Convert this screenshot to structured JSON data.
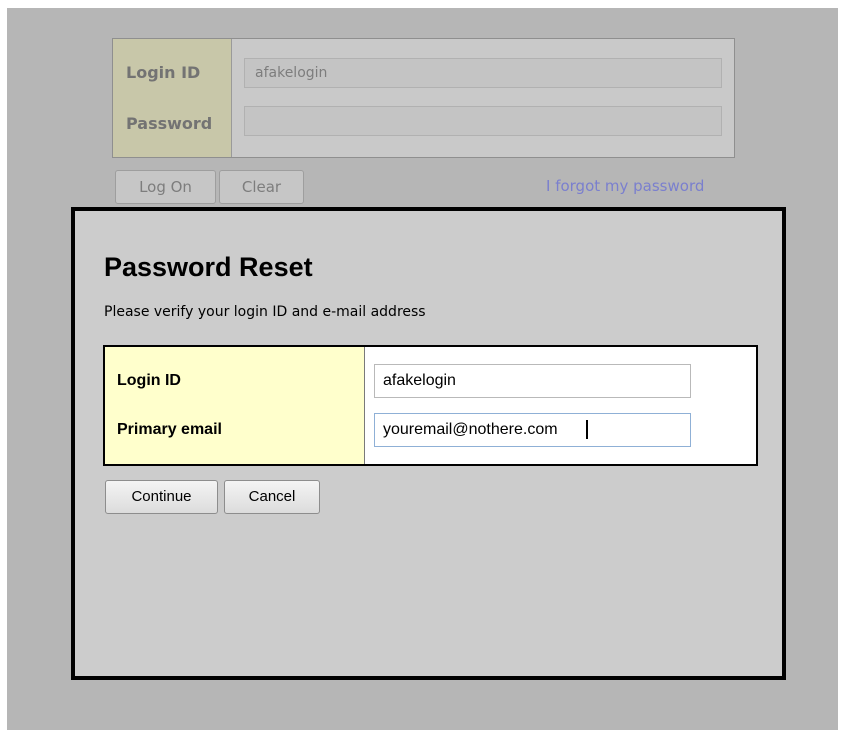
{
  "login_form": {
    "login_id_label": "Login ID",
    "login_id_value": "afakelogin",
    "password_label": "Password",
    "password_value": "",
    "logon_button": "Log On",
    "clear_button": "Clear",
    "forgot_link": "I forgot my password"
  },
  "reset_dialog": {
    "title": "Password Reset",
    "subtitle": "Please verify your login ID and e-mail address",
    "login_id_label": "Login ID",
    "login_id_value": "afakelogin",
    "email_label": "Primary email",
    "email_value": "youremail@nothere.com",
    "continue_button": "Continue",
    "cancel_button": "Cancel"
  },
  "colors": {
    "overlay_bg": "#b6b6b6",
    "dialog_bg": "#cccccc",
    "label_highlight": "#ffffcc",
    "link": "#7a7fce"
  }
}
